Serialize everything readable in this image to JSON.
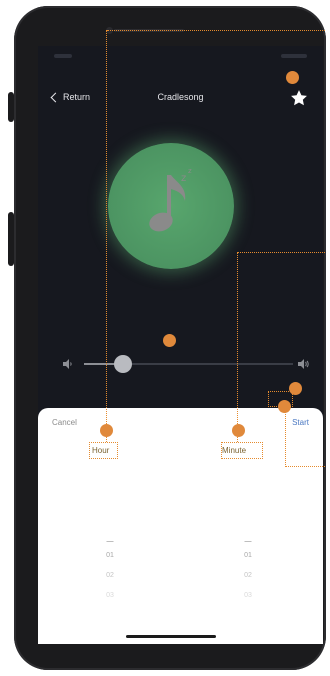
{
  "header": {
    "return_label": "Return",
    "title": "Cradlesong"
  },
  "player": {
    "volume_fraction": 0.22
  },
  "timer_sheet": {
    "cancel_label": "Cancel",
    "start_label": "Start",
    "hour_label": "Hour",
    "minute_label": "Minute",
    "hour_options": [
      "—",
      "01",
      "02",
      "03"
    ],
    "minute_options": [
      "—",
      "01",
      "02",
      "03"
    ]
  },
  "icons": {
    "back": "chevron-left-icon",
    "favorite": "star-icon",
    "music": "music-note-icon",
    "volume_low": "volume-low-icon",
    "volume_high": "volume-high-icon"
  },
  "colors": {
    "background": "#16181f",
    "disc": "#58a66d",
    "accent": "#4a78c2",
    "annotation": "#e58b2e"
  }
}
